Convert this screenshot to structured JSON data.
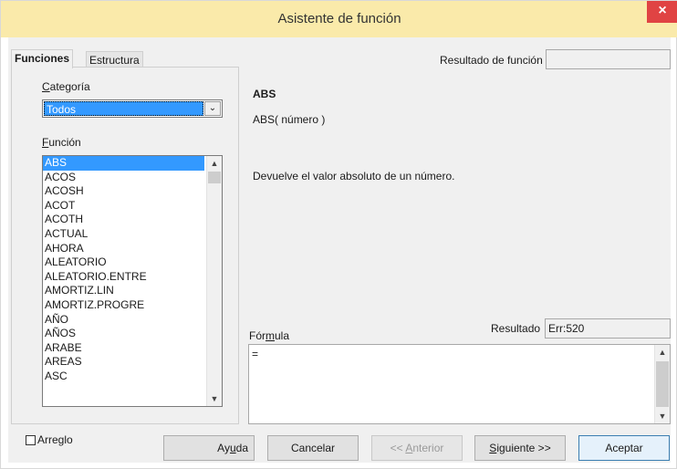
{
  "window": {
    "title": "Asistente de función",
    "close_icon": "×"
  },
  "tabs": [
    {
      "label": "Funciones",
      "active": true
    },
    {
      "label": "Estructura",
      "active": false
    }
  ],
  "category": {
    "label_prefix": "",
    "label_underline": "C",
    "label_rest": "ategoría",
    "value": "Todos"
  },
  "function_list": {
    "label_underline": "F",
    "label_rest": "unción",
    "items": [
      "ABS",
      "ACOS",
      "ACOSH",
      "ACOT",
      "ACOTH",
      "ACTUAL",
      "AHORA",
      "ALEATORIO",
      "ALEATORIO.ENTRE",
      "AMORTIZ.LIN",
      "AMORTIZ.PROGRE",
      "AÑO",
      "AÑOS",
      "ARABE",
      "AREAS",
      "ASC"
    ],
    "selected": "ABS"
  },
  "result_function": {
    "label": "Resultado de función",
    "value": ""
  },
  "details": {
    "name": "ABS",
    "signature": "ABS( número )",
    "description": "Devuelve el valor absoluto de un número."
  },
  "formula": {
    "label_pre": "Fór",
    "label_underline": "m",
    "label_post": "ula",
    "value": "="
  },
  "result": {
    "label": "Resultado",
    "value": "Err:520"
  },
  "array": {
    "label": "Arreglo",
    "checked": false
  },
  "buttons": {
    "help": {
      "pre": "Ay",
      "u": "u",
      "post": "da"
    },
    "cancel": "Cancelar",
    "prev": {
      "pre": "<< ",
      "u": "A",
      "post": "nterior"
    },
    "next": {
      "pre": "",
      "u": "S",
      "post": "iguiente >>"
    },
    "accept": "Aceptar"
  },
  "colors": {
    "titlebar": "#faeaaa",
    "selection": "#3399ff",
    "close": "#e04343"
  }
}
